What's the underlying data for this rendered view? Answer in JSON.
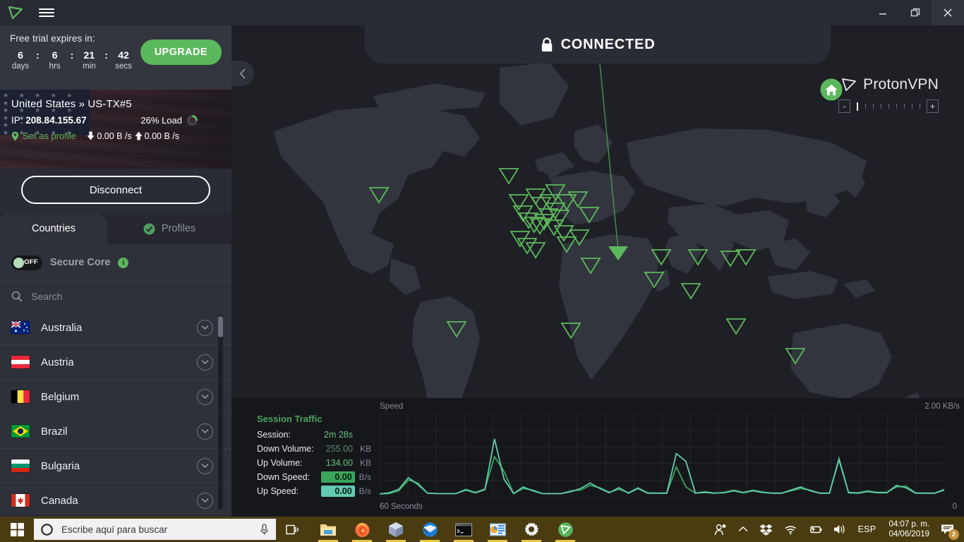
{
  "window": {
    "logo_icon": "protonvpn-logo-icon",
    "menu_icon": "hamburger-menu-icon",
    "minimize_icon": "minimize-icon",
    "restore_icon": "restore-icon",
    "close_icon": "close-icon"
  },
  "trial": {
    "title": "Free trial expires in:",
    "segments": [
      {
        "value": "6",
        "label": "days"
      },
      {
        "value": "6",
        "label": "hrs"
      },
      {
        "value": "21",
        "label": "min"
      },
      {
        "value": "42",
        "label": "secs"
      }
    ],
    "separator": ":",
    "upgrade_label": "UPGRADE"
  },
  "connection": {
    "server_name": "United States » US-TX#5",
    "ip_label": "IP:",
    "ip_value": "208.84.155.67",
    "load_text": "26% Load",
    "load_percent": 26,
    "set_as_profile": "Set as profile",
    "download_speed": "0.00 B /s",
    "upload_speed": "0.00 B /s",
    "disconnect_label": "Disconnect"
  },
  "tabs": {
    "countries": "Countries",
    "profiles": "Profiles"
  },
  "secure_core": {
    "toggle_state": "OFF",
    "label": "Secure Core",
    "info_icon": "info-icon"
  },
  "search": {
    "placeholder": "Search",
    "value": "",
    "icon": "search-icon"
  },
  "countries": [
    {
      "name": "Australia",
      "flag": "au"
    },
    {
      "name": "Austria",
      "flag": "at"
    },
    {
      "name": "Belgium",
      "flag": "be"
    },
    {
      "name": "Brazil",
      "flag": "br"
    },
    {
      "name": "Bulgaria",
      "flag": "bg"
    },
    {
      "name": "Canada",
      "flag": "ca"
    }
  ],
  "map": {
    "collapse_icon": "chevron-left-icon",
    "status_text": "CONNECTED",
    "lock_icon": "lock-icon",
    "home_icon": "home-icon",
    "brand_icon": "protonvpn-logo-icon",
    "brand_text": "ProtonVPN",
    "zoom_out_label": "-",
    "zoom_in_label": "+",
    "zoom_ticks": 9,
    "zoom_active_tick": 0
  },
  "session_traffic": {
    "title": "Session Traffic",
    "rows": [
      {
        "key": "Session:",
        "value": "2m 28s",
        "unit": "",
        "style": "plain"
      },
      {
        "key": "Down Volume:",
        "value": "255.00",
        "unit": "KB",
        "style": "dim"
      },
      {
        "key": "Up Volume:",
        "value": "134.00",
        "unit": "KB",
        "style": "plain"
      },
      {
        "key": "Down Speed:",
        "value": "0.00",
        "unit": "B/s",
        "style": "box"
      },
      {
        "key": "Up Speed:",
        "value": "0.00",
        "unit": "B/s",
        "style": "box2"
      }
    ]
  },
  "chart_data": {
    "type": "line",
    "title": "",
    "ylabel": "Speed",
    "xlabel": "60 Seconds",
    "ymax_label": "2.00  KB/s",
    "ymin_label": "0",
    "ylim": [
      0,
      2.0
    ],
    "xlim": [
      0,
      60
    ],
    "grid": true,
    "legend": "none",
    "colors": {
      "down": "#3aa55a",
      "up": "#63c9b0"
    },
    "series": [
      {
        "name": "Down Speed",
        "color": "#3aa55a",
        "values": [
          0.02,
          0.03,
          0.1,
          0.38,
          0.3,
          0.04,
          0.03,
          0.03,
          0.03,
          0.14,
          0.06,
          0.15,
          0.98,
          0.6,
          0.03,
          0.16,
          0.12,
          0.03,
          0.03,
          0.03,
          0.1,
          0.12,
          0.24,
          0.18,
          0.06,
          0.14,
          0.05,
          0.18,
          0.05,
          0.04,
          0.04,
          0.72,
          0.2,
          0.04,
          0.08,
          0.04,
          0.06,
          0.12,
          0.06,
          0.12,
          0.07,
          0.04,
          0.04,
          0.1,
          0.16,
          0.12,
          0.04,
          0.04,
          0.94,
          0.06,
          0.05,
          0.1,
          0.06,
          0.06,
          0.2,
          0.22,
          0.05,
          0.04,
          0.04,
          0.14
        ]
      },
      {
        "name": "Up Speed",
        "color": "#63c9b0",
        "values": [
          0.02,
          0.05,
          0.14,
          0.44,
          0.26,
          0.04,
          0.03,
          0.03,
          0.03,
          0.12,
          0.05,
          0.13,
          1.44,
          0.4,
          0.03,
          0.2,
          0.1,
          0.03,
          0.03,
          0.03,
          0.08,
          0.16,
          0.3,
          0.16,
          0.05,
          0.18,
          0.04,
          0.16,
          0.04,
          0.04,
          0.04,
          1.06,
          0.86,
          0.04,
          0.06,
          0.04,
          0.05,
          0.1,
          0.05,
          0.1,
          0.06,
          0.04,
          0.04,
          0.12,
          0.2,
          0.1,
          0.04,
          0.04,
          0.9,
          0.05,
          0.04,
          0.08,
          0.05,
          0.05,
          0.24,
          0.18,
          0.04,
          0.04,
          0.04,
          0.12
        ]
      }
    ]
  },
  "taskbar": {
    "start_icon": "windows-start-icon",
    "search_placeholder": "Escribe aquí para buscar",
    "search_icon": "cortana-circle-icon",
    "mic_icon": "microphone-icon",
    "taskview_icon": "task-view-icon",
    "apps": [
      {
        "name": "file-explorer",
        "open": true
      },
      {
        "name": "firefox",
        "open": true
      },
      {
        "name": "virtualbox",
        "open": true
      },
      {
        "name": "thunderbird",
        "open": true
      },
      {
        "name": "command-prompt",
        "open": true
      },
      {
        "name": "office-app",
        "open": true
      },
      {
        "name": "settings",
        "open": true
      },
      {
        "name": "protonvpn",
        "open": true
      }
    ],
    "tray": {
      "people_icon": "people-icon",
      "chevron_up_icon": "show-hidden-icons-icon",
      "dropbox_icon": "dropbox-icon",
      "wifi_icon": "wifi-icon",
      "battery_icon": "battery-icon",
      "volume_icon": "volume-icon",
      "language": "ESP",
      "time": "04:07 p. m.",
      "date": "04/06/2019",
      "action_center_icon": "action-center-icon",
      "notification_count": "2"
    }
  }
}
